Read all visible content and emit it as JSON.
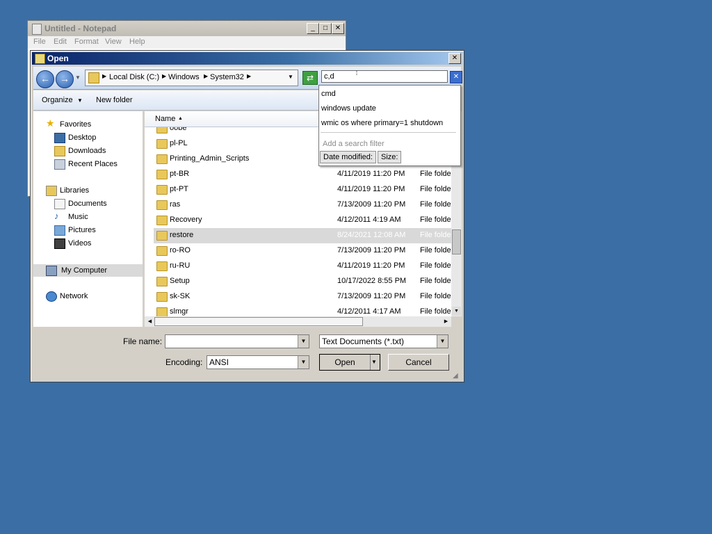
{
  "notepad": {
    "title": "Untitled - Notepad",
    "menu": [
      "File",
      "Edit",
      "Format",
      "View",
      "Help"
    ]
  },
  "dialog": {
    "title": "Open",
    "breadcrumb": [
      "Local Disk (C:)",
      "Windows",
      "System32"
    ],
    "search_value": "c,d",
    "toolbar": {
      "organize": "Organize",
      "new_folder": "New folder"
    },
    "nav": {
      "favorites": "Favorites",
      "desktop": "Desktop",
      "downloads": "Downloads",
      "recent": "Recent Places",
      "libraries": "Libraries",
      "documents": "Documents",
      "music": "Music",
      "pictures": "Pictures",
      "videos": "Videos",
      "computer": "My Computer",
      "network": "Network"
    },
    "columns": {
      "name": "Name"
    },
    "files": [
      {
        "name": "oobe",
        "date": "",
        "type": ""
      },
      {
        "name": "pl-PL",
        "date": "",
        "type": ""
      },
      {
        "name": "Printing_Admin_Scripts",
        "date": "",
        "type": ""
      },
      {
        "name": "pt-BR",
        "date": "4/11/2019 11:20 PM",
        "type": "File folder"
      },
      {
        "name": "pt-PT",
        "date": "4/11/2019 11:20 PM",
        "type": "File folder"
      },
      {
        "name": "ras",
        "date": "7/13/2009 11:20 PM",
        "type": "File folder"
      },
      {
        "name": "Recovery",
        "date": "4/12/2011 4:19 AM",
        "type": "File folder"
      },
      {
        "name": "restore",
        "date": "8/24/2021 12:08 AM",
        "type": "File folder"
      },
      {
        "name": "ro-RO",
        "date": "7/13/2009 11:20 PM",
        "type": "File folder"
      },
      {
        "name": "ru-RU",
        "date": "4/11/2019 11:20 PM",
        "type": "File folder"
      },
      {
        "name": "Setup",
        "date": "10/17/2022 8:55 PM",
        "type": "File folder"
      },
      {
        "name": "sk-SK",
        "date": "7/13/2009 11:20 PM",
        "type": "File folder"
      },
      {
        "name": "slmgr",
        "date": "4/12/2011 4:17 AM",
        "type": "File folder"
      }
    ],
    "filename_label": "File name:",
    "filename_value": "",
    "filetype_value": "Text Documents (*.txt)",
    "encoding_label": "Encoding:",
    "encoding_value": "ANSI",
    "open_label": "Open",
    "cancel_label": "Cancel"
  },
  "suggestions": {
    "items": [
      "cmd",
      "windows update",
      "wmic os where primary=1 shutdown"
    ],
    "hint": "Add a search filter",
    "filter_date": "Date modified:",
    "filter_size": "Size:"
  }
}
